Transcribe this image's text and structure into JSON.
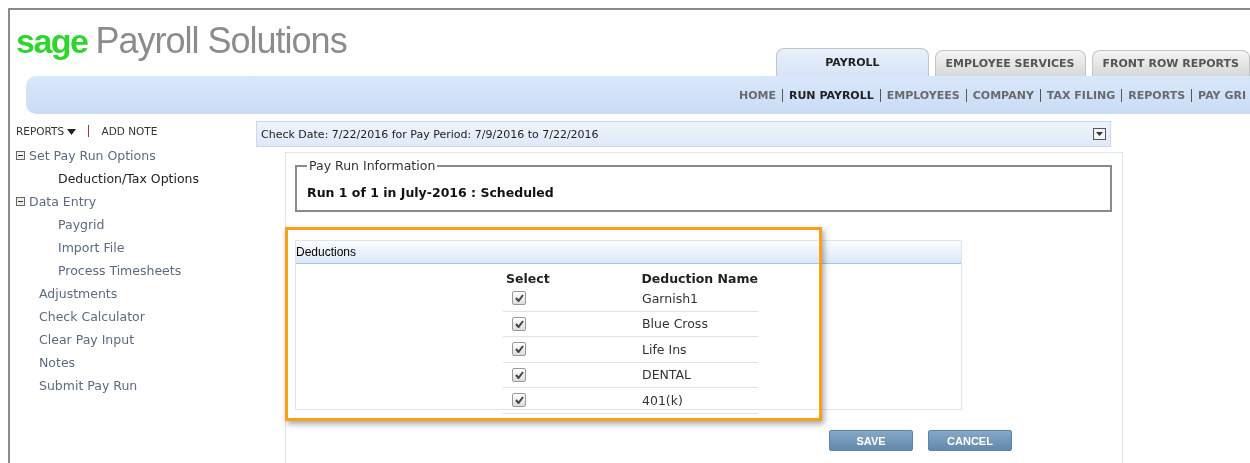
{
  "logo": {
    "brand": "sage",
    "product": "Payroll Solutions"
  },
  "tabs": [
    {
      "label": "PAYROLL",
      "selected": true
    },
    {
      "label": "EMPLOYEE SERVICES",
      "selected": false
    },
    {
      "label": "FRONT ROW REPORTS",
      "selected": false
    }
  ],
  "nav": [
    {
      "label": "HOME",
      "selected": false
    },
    {
      "label": "RUN PAYROLL",
      "selected": true
    },
    {
      "label": "EMPLOYEES",
      "selected": false
    },
    {
      "label": "COMPANY",
      "selected": false
    },
    {
      "label": "TAX FILING",
      "selected": false
    },
    {
      "label": "REPORTS",
      "selected": false
    },
    {
      "label": "PAY GRI",
      "selected": false
    }
  ],
  "sidebar": {
    "reports": "REPORTS",
    "add_note": "ADD NOTE",
    "items": [
      {
        "label": "Set Pay Run Options",
        "expanded": true,
        "selected": false,
        "children": [
          {
            "label": "Deduction/Tax Options",
            "selected": true
          }
        ]
      },
      {
        "label": "Data Entry",
        "expanded": true,
        "selected": false,
        "children": [
          {
            "label": "Paygrid",
            "selected": false
          },
          {
            "label": "Import File",
            "selected": false
          },
          {
            "label": "Process Timesheets",
            "selected": false
          }
        ]
      },
      {
        "label": "Adjustments",
        "selected": false
      },
      {
        "label": "Check Calculator",
        "selected": false
      },
      {
        "label": "Clear Pay Input",
        "selected": false
      },
      {
        "label": "Notes",
        "selected": false
      },
      {
        "label": "Submit Pay Run",
        "selected": false
      }
    ]
  },
  "check_date": "Check Date: 7/22/2016 for Pay Period: 7/9/2016 to 7/22/2016",
  "pay_run": {
    "legend": "Pay Run Information",
    "status": "Run 1 of 1 in July-2016 : Scheduled"
  },
  "deductions": {
    "title": "Deductions",
    "columns": [
      "Select",
      "Deduction Name"
    ],
    "rows": [
      {
        "name": "Garnish1",
        "checked": true
      },
      {
        "name": "Blue Cross",
        "checked": true
      },
      {
        "name": "Life Ins",
        "checked": true
      },
      {
        "name": "DENTAL",
        "checked": true
      },
      {
        "name": "401(k)",
        "checked": true
      }
    ]
  },
  "buttons": [
    "SAVE",
    "CANCEL"
  ]
}
